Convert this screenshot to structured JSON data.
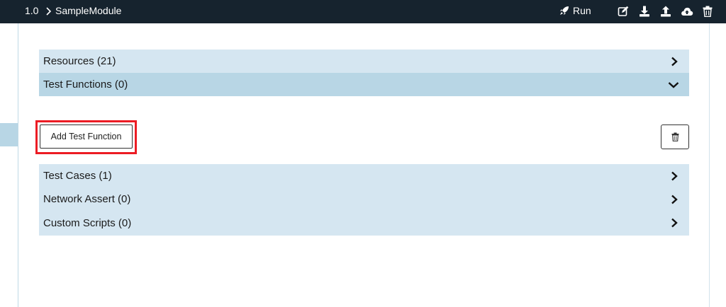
{
  "header": {
    "version": "1.0",
    "module": "SampleModule",
    "run_label": "Run",
    "icons": [
      "edit-icon",
      "download-icon",
      "upload-icon",
      "cloud-upload-icon",
      "trash-icon"
    ]
  },
  "sections": {
    "resources": "Resources (21)",
    "test_functions": "Test Functions (0)",
    "test_cases": "Test Cases (1)",
    "network_assert": "Network Assert (0)",
    "custom_scripts": "Custom Scripts (0)"
  },
  "actions": {
    "add_test_function": "Add Test Function"
  },
  "colors": {
    "topbar": "#16232e",
    "row_light": "#d5e6f1",
    "row_dark": "#b8d6e5",
    "highlight": "#ec1c24"
  }
}
